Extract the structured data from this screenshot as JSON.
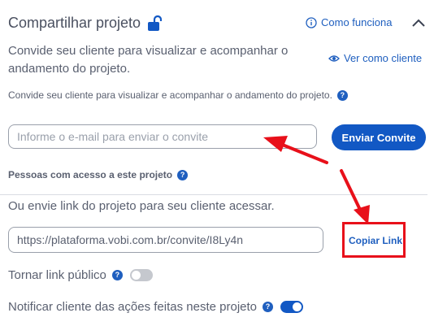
{
  "header": {
    "title": "Compartilhar projeto",
    "how_it_works": "Como funciona"
  },
  "description": "Convide seu cliente para visualizar e acompanhar o andamento do projeto.",
  "view_as_client": "Ver como cliente",
  "description_small": "Convide seu cliente para visualizar e acompanhar o andamento do projeto.",
  "invite": {
    "placeholder": "Informe o e-mail para enviar o convite",
    "value": "",
    "button": "Enviar Convite"
  },
  "access_label": "Pessoas com acesso a este projeto",
  "link_section": {
    "text": "Ou envie link do projeto para seu cliente acessar.",
    "url": "https://plataforma.vobi.com.br/convite/I8Ly4n",
    "copy_label": "Copiar Link"
  },
  "toggles": {
    "public_label": "Tornar link público",
    "public_state": false,
    "notify_label": "Notificar cliente das ações feitas neste projeto",
    "notify_state": true
  },
  "colors": {
    "accent": "#1258c4",
    "annotation": "#e8101a"
  }
}
